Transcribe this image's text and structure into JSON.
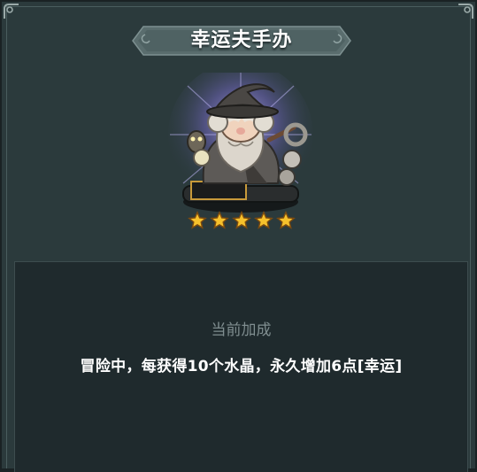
{
  "header": {
    "title": "幸运夫手办"
  },
  "figure": {
    "icon": "wizard-figurine-icon",
    "rating_stars": 5,
    "rating_max": 5
  },
  "bonus": {
    "section_label": "当前加成",
    "description": "冒险中，每获得10个水晶，永久增加6点[幸运]"
  },
  "colors": {
    "panel_bg": "#2b3a3c",
    "info_bg": "#1f2a2d",
    "star_gold": "#f6c12c",
    "title_text": "#ffffff",
    "label_grey": "#7f8d8f"
  }
}
